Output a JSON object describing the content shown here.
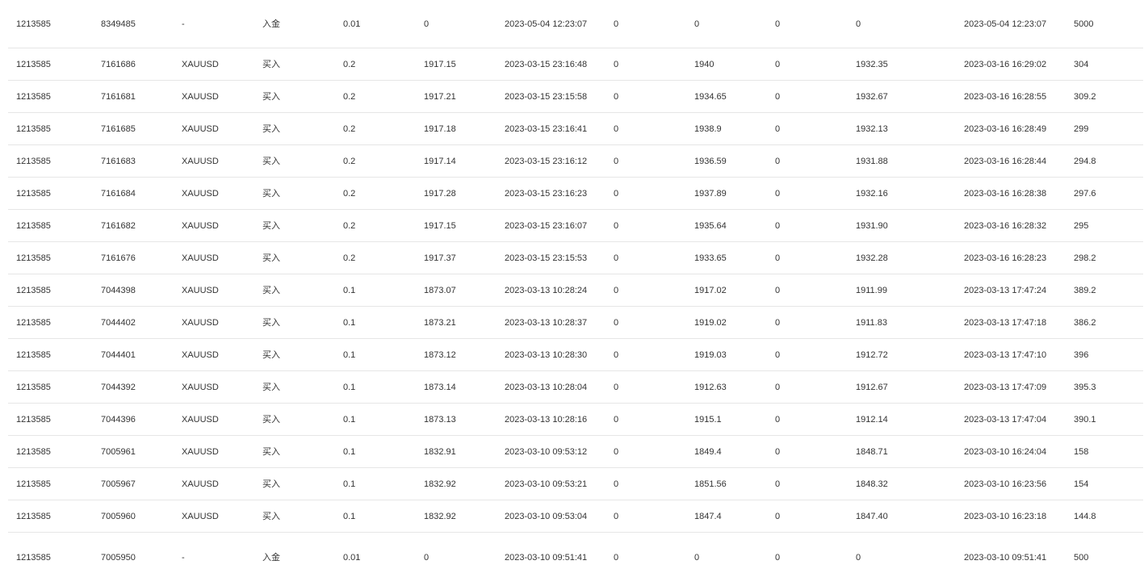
{
  "table": {
    "rows": [
      [
        "1213585",
        "8349485",
        "-",
        "入金",
        "0.01",
        "0",
        "2023-05-04 12:23:07",
        "0",
        "0",
        "0",
        "0",
        "2023-05-04 12:23:07",
        "5000"
      ],
      [
        "1213585",
        "7161686",
        "XAUUSD",
        "买入",
        "0.2",
        "1917.15",
        "2023-03-15 23:16:48",
        "0",
        "1940",
        "0",
        "1932.35",
        "2023-03-16 16:29:02",
        "304"
      ],
      [
        "1213585",
        "7161681",
        "XAUUSD",
        "买入",
        "0.2",
        "1917.21",
        "2023-03-15 23:15:58",
        "0",
        "1934.65",
        "0",
        "1932.67",
        "2023-03-16 16:28:55",
        "309.2"
      ],
      [
        "1213585",
        "7161685",
        "XAUUSD",
        "买入",
        "0.2",
        "1917.18",
        "2023-03-15 23:16:41",
        "0",
        "1938.9",
        "0",
        "1932.13",
        "2023-03-16 16:28:49",
        "299"
      ],
      [
        "1213585",
        "7161683",
        "XAUUSD",
        "买入",
        "0.2",
        "1917.14",
        "2023-03-15 23:16:12",
        "0",
        "1936.59",
        "0",
        "1931.88",
        "2023-03-16 16:28:44",
        "294.8"
      ],
      [
        "1213585",
        "7161684",
        "XAUUSD",
        "买入",
        "0.2",
        "1917.28",
        "2023-03-15 23:16:23",
        "0",
        "1937.89",
        "0",
        "1932.16",
        "2023-03-16 16:28:38",
        "297.6"
      ],
      [
        "1213585",
        "7161682",
        "XAUUSD",
        "买入",
        "0.2",
        "1917.15",
        "2023-03-15 23:16:07",
        "0",
        "1935.64",
        "0",
        "1931.90",
        "2023-03-16 16:28:32",
        "295"
      ],
      [
        "1213585",
        "7161676",
        "XAUUSD",
        "买入",
        "0.2",
        "1917.37",
        "2023-03-15 23:15:53",
        "0",
        "1933.65",
        "0",
        "1932.28",
        "2023-03-16 16:28:23",
        "298.2"
      ],
      [
        "1213585",
        "7044398",
        "XAUUSD",
        "买入",
        "0.1",
        "1873.07",
        "2023-03-13 10:28:24",
        "0",
        "1917.02",
        "0",
        "1911.99",
        "2023-03-13 17:47:24",
        "389.2"
      ],
      [
        "1213585",
        "7044402",
        "XAUUSD",
        "买入",
        "0.1",
        "1873.21",
        "2023-03-13 10:28:37",
        "0",
        "1919.02",
        "0",
        "1911.83",
        "2023-03-13 17:47:18",
        "386.2"
      ],
      [
        "1213585",
        "7044401",
        "XAUUSD",
        "买入",
        "0.1",
        "1873.12",
        "2023-03-13 10:28:30",
        "0",
        "1919.03",
        "0",
        "1912.72",
        "2023-03-13 17:47:10",
        "396"
      ],
      [
        "1213585",
        "7044392",
        "XAUUSD",
        "买入",
        "0.1",
        "1873.14",
        "2023-03-13 10:28:04",
        "0",
        "1912.63",
        "0",
        "1912.67",
        "2023-03-13 17:47:09",
        "395.3"
      ],
      [
        "1213585",
        "7044396",
        "XAUUSD",
        "买入",
        "0.1",
        "1873.13",
        "2023-03-13 10:28:16",
        "0",
        "1915.1",
        "0",
        "1912.14",
        "2023-03-13 17:47:04",
        "390.1"
      ],
      [
        "1213585",
        "7005961",
        "XAUUSD",
        "买入",
        "0.1",
        "1832.91",
        "2023-03-10 09:53:12",
        "0",
        "1849.4",
        "0",
        "1848.71",
        "2023-03-10 16:24:04",
        "158"
      ],
      [
        "1213585",
        "7005967",
        "XAUUSD",
        "买入",
        "0.1",
        "1832.92",
        "2023-03-10 09:53:21",
        "0",
        "1851.56",
        "0",
        "1848.32",
        "2023-03-10 16:23:56",
        "154"
      ],
      [
        "1213585",
        "7005960",
        "XAUUSD",
        "买入",
        "0.1",
        "1832.92",
        "2023-03-10 09:53:04",
        "0",
        "1847.4",
        "0",
        "1847.40",
        "2023-03-10 16:23:18",
        "144.8"
      ],
      [
        "1213585",
        "7005950",
        "-",
        "入金",
        "0.01",
        "0",
        "2023-03-10 09:51:41",
        "0",
        "0",
        "0",
        "0",
        "2023-03-10 09:51:41",
        "500"
      ]
    ]
  }
}
